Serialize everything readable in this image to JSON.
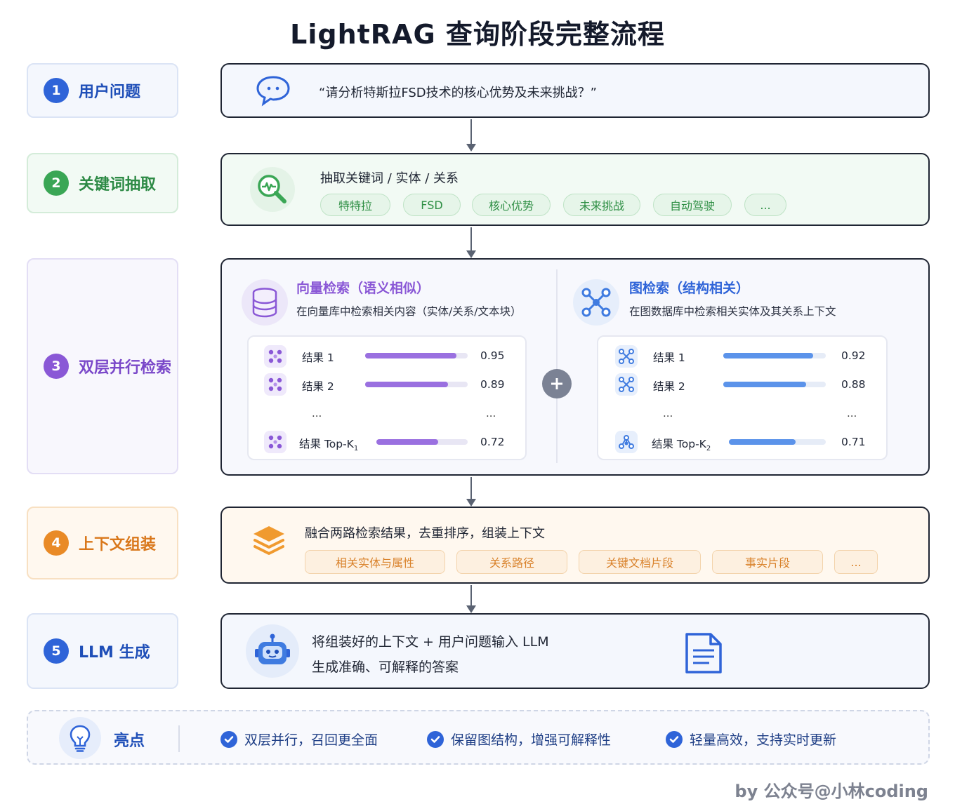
{
  "title": "LightRAG 查询阶段完整流程",
  "colors": {
    "blue": "#2f64d8",
    "green": "#3aa655",
    "purple": "#8a58d6",
    "orange": "#e98a26",
    "vector_bar": "#9a70e0",
    "graph_bar": "#5b93ea"
  },
  "steps": [
    {
      "num": "1",
      "label": "用户问题"
    },
    {
      "num": "2",
      "label": "关键词抽取"
    },
    {
      "num": "3",
      "label": "双层并行检索"
    },
    {
      "num": "4",
      "label": "上下文组装"
    },
    {
      "num": "5",
      "label": "LLM 生成"
    }
  ],
  "question": {
    "icon": "chat-bubble-icon",
    "text": "“请分析特斯拉FSD技术的核心优势及未来挑战？”"
  },
  "keywords": {
    "icon": "magnifier-analysis-icon",
    "heading": "抽取关键词 / 实体 / 关系",
    "chips": [
      "特特拉",
      "FSD",
      "核心优势",
      "未来挑战",
      "自动驾驶",
      "..."
    ]
  },
  "retrieval": {
    "plus_icon": "plus-icon",
    "vector": {
      "icon": "database-icon",
      "title": "向量检索（语义相似）",
      "desc": "在向量库中检索相关内容（实体/关系/文本块）",
      "rows": [
        {
          "label": "结果 1",
          "score": 0.95,
          "score_text": "0.95",
          "fill": 0.89
        },
        {
          "label": "结果 2",
          "score": 0.89,
          "score_text": "0.89",
          "fill": 0.81
        },
        {
          "label": "结果 Top-K",
          "sub": "1",
          "score": 0.72,
          "score_text": "0.72",
          "fill": 0.68
        }
      ],
      "ellipsis_left": "...",
      "ellipsis_right": "..."
    },
    "graph": {
      "icon": "network-graph-icon",
      "title": "图检索（结构相关）",
      "desc": "在图数据库中检索相关实体及其关系上下文",
      "rows": [
        {
          "label": "结果 1",
          "score": 0.92,
          "score_text": "0.92",
          "fill": 0.88
        },
        {
          "label": "结果 2",
          "score": 0.88,
          "score_text": "0.88",
          "fill": 0.81
        },
        {
          "label": "结果 Top-K",
          "sub": "2",
          "score": 0.71,
          "score_text": "0.71",
          "fill": 0.69
        }
      ],
      "ellipsis_left": "...",
      "ellipsis_right": "..."
    }
  },
  "context": {
    "icon": "layers-icon",
    "heading": "融合两路检索结果，去重排序，组装上下文",
    "chips": [
      "相关实体与属性",
      "关系路径",
      "关键文档片段",
      "事实片段",
      "..."
    ]
  },
  "generation": {
    "icon": "robot-icon",
    "doc_icon": "document-icon",
    "line1": "将组装好的上下文 + 用户问题输入 LLM",
    "line2": "生成准确、可解释的答案"
  },
  "highlights": {
    "icon": "lightbulb-icon",
    "label": "亮点",
    "items": [
      "双层并行，召回更全面",
      "保留图结构，增强可解释性",
      "轻量高效，支持实时更新"
    ]
  },
  "footer": "by 公众号@小林coding"
}
